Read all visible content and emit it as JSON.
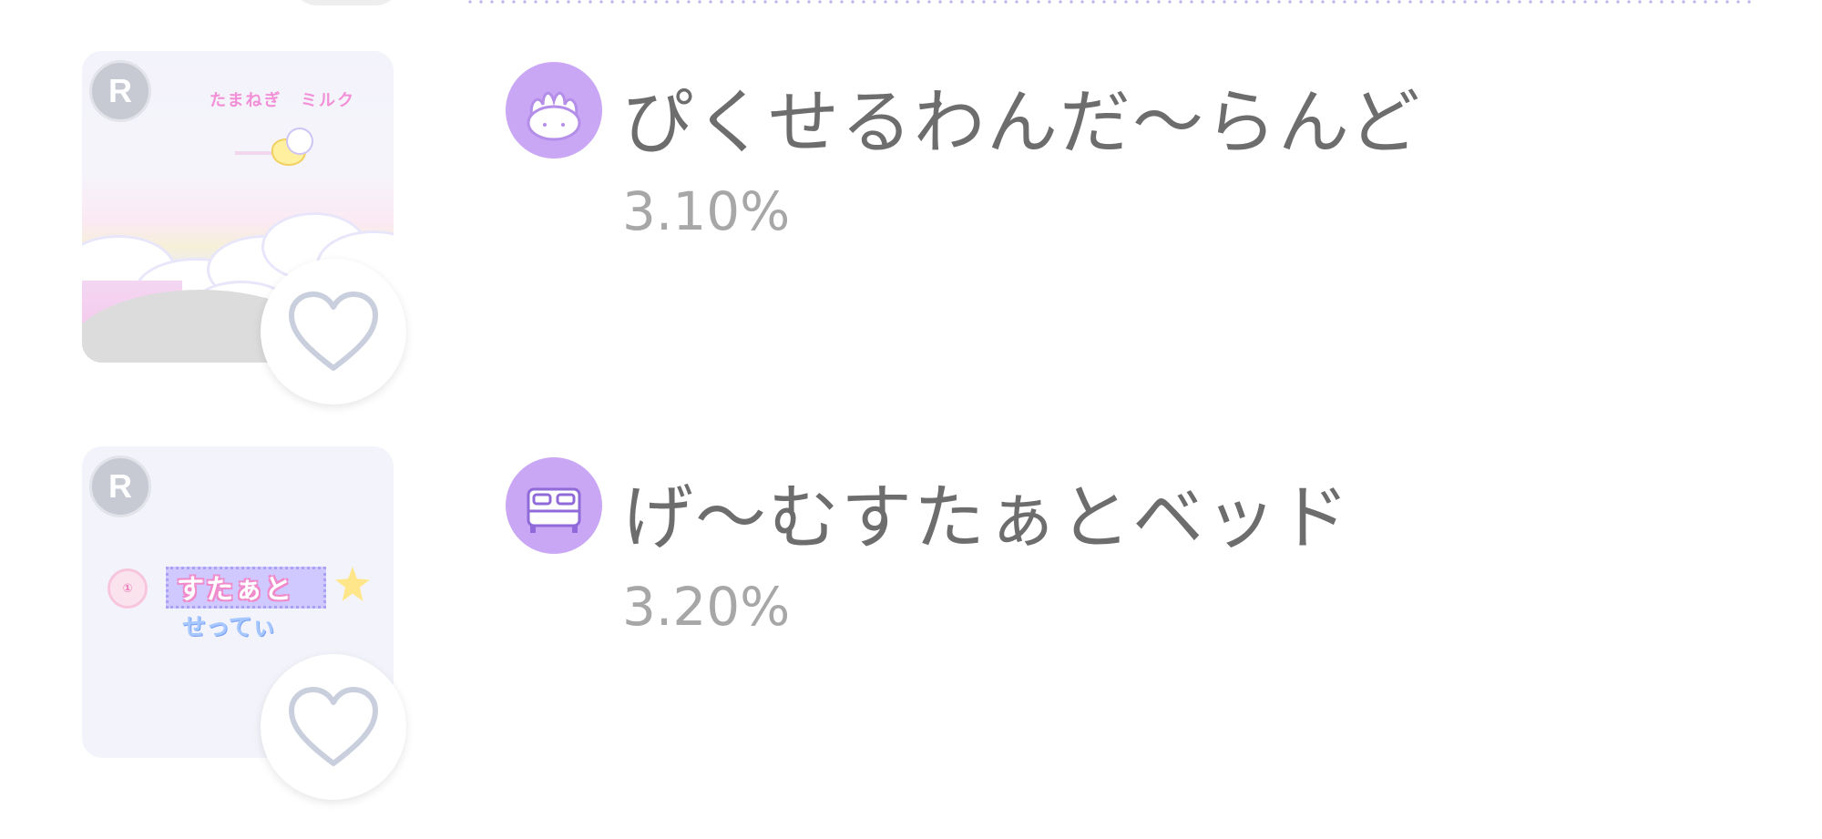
{
  "list": {
    "items": [
      {
        "rank_badge": "R",
        "thumbnail": {
          "pixel_texts": [
            "たまねぎ",
            "ミルク"
          ]
        },
        "category_icon": "frilly-cushion-icon",
        "title": "ぴくせるわんだ〜らんど",
        "percent": "3.10%",
        "favorite_icon": "heart-outline-icon"
      },
      {
        "rank_badge": "R",
        "thumbnail": {
          "badge_text": "①",
          "banner_text": "すたぁと",
          "sub_text": "せってぃ"
        },
        "category_icon": "bed-icon",
        "title": "げ〜むすたぁとベッド",
        "percent": "3.20%",
        "favorite_icon": "heart-outline-icon"
      }
    ]
  },
  "colors": {
    "title": "#6d6d6d",
    "percent": "#a7a7a7",
    "category_icon_bg": "#c9a7f4",
    "divider": "#b9b4ee"
  }
}
